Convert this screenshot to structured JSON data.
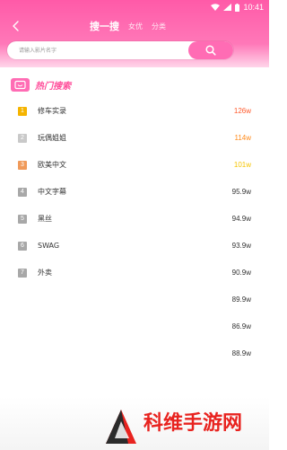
{
  "status_bar": {
    "time": "10:41"
  },
  "header": {
    "tabs": [
      {
        "label": "搜一搜",
        "active": true
      },
      {
        "label": "女优",
        "active": false
      },
      {
        "label": "分类",
        "active": false
      }
    ]
  },
  "search": {
    "placeholder": "请输入影片名字",
    "value": ""
  },
  "hot_section": {
    "title": "热门搜索"
  },
  "hot_list": [
    {
      "rank": "1",
      "title": "修车实录",
      "count": "126w",
      "rank_color": "#f5b400",
      "count_color": "#ff5a2c"
    },
    {
      "rank": "2",
      "title": "玩偶姐姐",
      "count": "114w",
      "rank_color": "#c9c9c9",
      "count_color": "#ff8a1a"
    },
    {
      "rank": "3",
      "title": "欧美中文",
      "count": "101w",
      "rank_color": "#f09a5a",
      "count_color": "#f5c400"
    },
    {
      "rank": "4",
      "title": "中文字幕",
      "count": "95.9w",
      "rank_color": "#a8a8a8",
      "count_color": "#333333"
    },
    {
      "rank": "5",
      "title": "黑丝",
      "count": "94.9w",
      "rank_color": "#a8a8a8",
      "count_color": "#333333"
    },
    {
      "rank": "6",
      "title": "SWAG",
      "count": "93.9w",
      "rank_color": "#a8a8a8",
      "count_color": "#333333"
    },
    {
      "rank": "7",
      "title": "外卖",
      "count": "90.9w",
      "rank_color": "#a8a8a8",
      "count_color": "#333333"
    },
    {
      "rank": "",
      "title": "",
      "count": "89.9w",
      "rank_color": "",
      "count_color": "#333333"
    },
    {
      "rank": "",
      "title": "",
      "count": "86.9w",
      "rank_color": "",
      "count_color": "#333333"
    },
    {
      "rank": "",
      "title": "",
      "count": "88.9w",
      "rank_color": "",
      "count_color": "#333333"
    }
  ],
  "watermark": {
    "text": "科维手游网"
  },
  "colors": {
    "accent": "#ff5aa8",
    "search_button": "#ff6cb4",
    "watermark_red": "#e8231f"
  }
}
